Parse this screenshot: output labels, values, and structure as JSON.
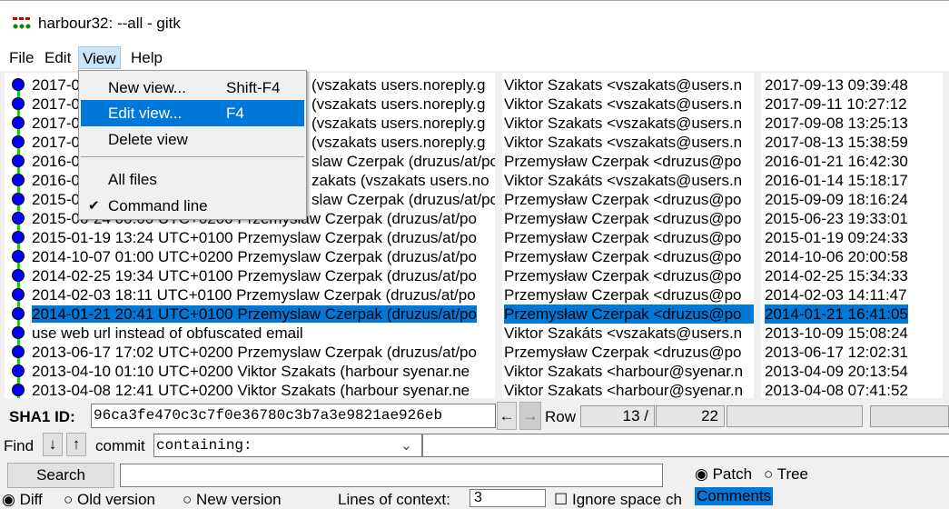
{
  "window": {
    "title": "harbour32: --all - gitk"
  },
  "menubar": [
    "File",
    "Edit",
    "View",
    "Help"
  ],
  "view_menu": {
    "items": [
      {
        "label": "New view...",
        "shortcut": "Shift-F4"
      },
      {
        "label": "Edit view...",
        "shortcut": "F4"
      },
      {
        "label": "Delete view",
        "shortcut": ""
      },
      {
        "label": "All files",
        "shortcut": ""
      },
      {
        "label": "Command line",
        "shortcut": "",
        "checked": true
      }
    ]
  },
  "commits": [
    {
      "head": "2017-0",
      "tail": "(vszakats users.noreply.g",
      "author": "Viktor Szakats <vszakats@users.n",
      "date": "2017-09-13 09:39:48"
    },
    {
      "head": "2017-0",
      "tail": "(vszakats users.noreply.g",
      "author": "Viktor Szakats <vszakats@users.n",
      "date": "2017-09-11 10:27:12"
    },
    {
      "head": "2017-0",
      "tail": "(vszakats users.noreply.g",
      "author": "Viktor Szakats <vszakats@users.n",
      "date": "2017-09-08 13:25:13"
    },
    {
      "head": "2017-0",
      "tail": "(vszakats users.noreply.g",
      "author": "Viktor Szakats <vszakats@users.n",
      "date": "2017-08-13 15:38:59"
    },
    {
      "head": "2016-0",
      "tail": "slaw Czerpak (druzus/at/po",
      "author": "Przemysław Czerpak <druzus@po",
      "date": "2016-01-21 16:42:30"
    },
    {
      "head": "2016-0",
      "tail": "zakats (vszakats users.no",
      "author": "Viktor Szakáts <vszakats@users.n",
      "date": "2016-01-14 15:18:17"
    },
    {
      "head": "2015-0",
      "tail": "slaw Czerpak (druzus/at/po",
      "author": "Przemysław Czerpak <druzus@po",
      "date": "2015-09-09 18:16:24"
    },
    {
      "head": "2015-06-24 00:00 UTC+0200 Przemyslaw Czerpak (druzus/at/po",
      "tail": "",
      "author": "Przemysław Czerpak <druzus@po",
      "date": "2015-06-23 19:33:01"
    },
    {
      "head": "2015-01-19 13:24 UTC+0100 Przemyslaw Czerpak (druzus/at/po",
      "tail": "",
      "author": "Przemysław Czerpak <druzus@po",
      "date": "2015-01-19 09:24:33"
    },
    {
      "head": "2014-10-07 01:00 UTC+0200 Przemyslaw Czerpak (druzus/at/po",
      "tail": "",
      "author": "Przemysław Czerpak <druzus@po",
      "date": "2014-10-06 20:00:58"
    },
    {
      "head": "2014-02-25 19:34 UTC+0100 Przemyslaw Czerpak (druzus/at/po",
      "tail": "",
      "author": "Przemysław Czerpak <druzus@po",
      "date": "2014-02-25 15:34:33"
    },
    {
      "head": "2014-02-03 18:11 UTC+0100 Przemyslaw Czerpak (druzus/at/po",
      "tail": "",
      "author": "Przemysław Czerpak <druzus@po",
      "date": "2014-02-03 14:11:47"
    },
    {
      "head": "2014-01-21 20:41 UTC+0100 Przemyslaw Czerpak (druzus/at/po",
      "tail": "",
      "author": "Przemysław Czerpak <druzus@po",
      "date": "2014-01-21 16:41:05",
      "selected": true
    },
    {
      "head": "use web url instead of obfuscated email",
      "tail": "",
      "author": "Viktor Szakáts <vszakats@users.n",
      "date": "2013-10-09 15:08:24"
    },
    {
      "head": "2013-06-17 17:02 UTC+0200 Przemyslaw Czerpak (druzus/at/po",
      "tail": "",
      "author": "Przemysław Czerpak <druzus@po",
      "date": "2013-06-17 12:02:31"
    },
    {
      "head": "2013-04-10 01:10 UTC+0200 Viktor Szakats (harbour syenar.ne",
      "tail": "",
      "author": "Viktor Szakats <harbour@syenar.n",
      "date": "2013-04-09 20:13:54"
    },
    {
      "head": "2013-04-08 12:41 UTC+0200 Viktor Szakats (harbour syenar.ne",
      "tail": "",
      "author": "Viktor Szakats <harbour@syenar.n",
      "date": "2013-04-08 07:41:52"
    }
  ],
  "sha": {
    "label": "SHA1 ID:",
    "value": "96ca3fe470c3c7f0e36780c3b7a3e9821ae926eb",
    "back": "←",
    "fwd": "→"
  },
  "row": {
    "label": "Row",
    "current": "13 /",
    "total": "22"
  },
  "find": {
    "label": "Find",
    "down": "↓",
    "up": "↑",
    "type": "commit",
    "mode": "containing:",
    "value": ""
  },
  "search": {
    "button": "Search",
    "value": ""
  },
  "view_mode": {
    "patch": "Patch",
    "tree": "Tree"
  },
  "diff": {
    "diff": "Diff",
    "old": "Old version",
    "new": "New version",
    "context_label": "Lines of context:",
    "context": "3",
    "ignore": "Ignore space ch",
    "comments": "Comments"
  },
  "colors": {
    "selected": "#0078d7",
    "graph_line": "#00e000",
    "node": "#0000ff"
  }
}
